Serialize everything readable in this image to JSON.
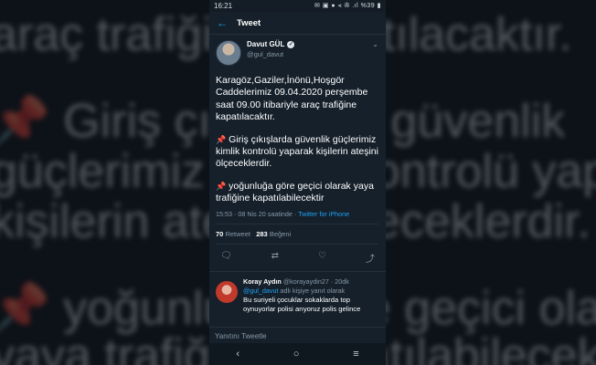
{
  "status": {
    "time": "16:21",
    "right": "✉ ▣ ●  ⫷ ✇ .ıl %39 ▮"
  },
  "appbar": {
    "back_icon": "arrow-left-icon",
    "title": "Tweet"
  },
  "tweet": {
    "display_name": "Davut GÜL",
    "handle": "@gul_davut",
    "paragraph1": "Karagöz,Gaziler,İnönü,Hoşgör Caddelerimiz 09.04.2020 perşembe saat 09.00 itibariyle araç trafiğine kapatılacaktır.",
    "paragraph2": "Giriş çıkışlarda güvenlik güçlerimiz kimlik kontrolü yaparak kişilerin ateşini ölçeceklerdir.",
    "paragraph3": "yoğunluğa göre geçici olarak yaya trafiğine kapatılabilecektir",
    "time": "15:53 · 08 Nis 20 saatinde · ",
    "source": "Twitter for iPhone",
    "retweets_count": "70",
    "retweets_label": "Retweet",
    "likes_count": "283",
    "likes_label": "Beğeni"
  },
  "actions": {
    "reply": "☰",
    "retweet": "⇄",
    "like": "♡",
    "share": "➦"
  },
  "reply": {
    "name": "Koray Aydın",
    "handle": "@korayaydin27 · 20dk",
    "mention": "@gul_davut",
    "mention_suffix": " adlı kişiye yanıt olarak",
    "text": "Bu suriyeli çocuklar sokaklarda top oynuyorlar polisi arıyoruz polis gelince"
  },
  "reply_field": {
    "placeholder": "Yanıtını Tweetle"
  },
  "background": {
    "line1": "araç trafiğine kapatılacaktır.",
    "line2": "Giriş çıkışlarda güvenlik",
    "line3": "güçlerimiz kimlik kontrolü yaparak",
    "line4": "kişilerin ateşini ölçeceklerdir.",
    "line5": "yoğunluğa göre geçici olarak",
    "line6": "yaya trafiğine kapatılabilecektir"
  }
}
